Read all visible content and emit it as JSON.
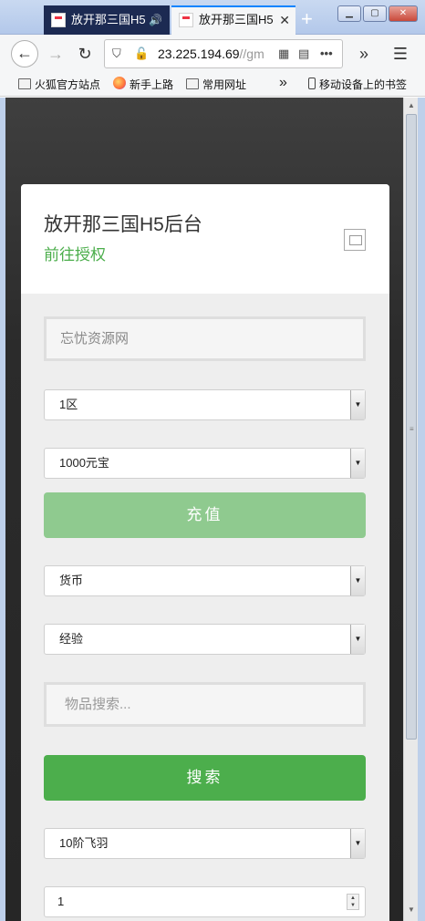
{
  "browser": {
    "tabs": [
      {
        "title": "放开那三国H5",
        "active": false,
        "audio": true
      },
      {
        "title": "放开那三国H5",
        "active": true
      }
    ],
    "url_host": "23.225.194.69",
    "url_path": "//gm",
    "bookmarks": [
      "火狐官方站点",
      "新手上路",
      "常用网址",
      "移动设备上的书签"
    ]
  },
  "page": {
    "title": "放开那三国H5后台",
    "auth_link": "前往授权",
    "account_placeholder": "忘忧资源网",
    "server_select": "1区",
    "recharge_select": "1000元宝",
    "recharge_button": "充值",
    "currency_select": "货币",
    "exp_select": "经验",
    "item_search_placeholder": "物品搜索...",
    "search_button": "搜索",
    "item_select": "10阶飞羽",
    "quantity": "1"
  },
  "colors": {
    "accent_green": "#4cae4c",
    "disabled_green": "#8fca8f",
    "tab_dark": "#1c2a52"
  }
}
